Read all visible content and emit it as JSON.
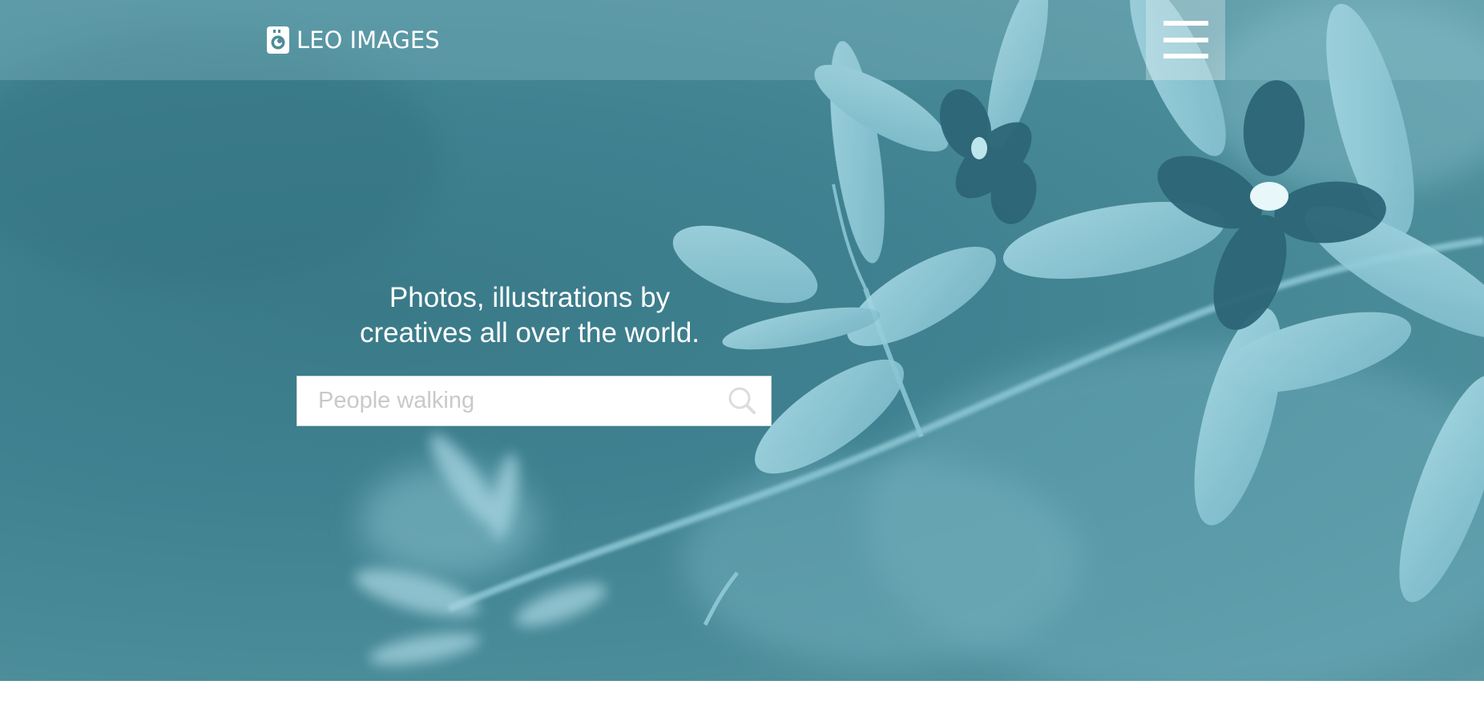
{
  "brand": {
    "name": "LEO IMAGES",
    "icon": "camera-logo-icon"
  },
  "header": {
    "menu_icon": "hamburger-menu-icon"
  },
  "hero": {
    "headline_line1": "Photos, illustrations by",
    "headline_line2": "creatives all over the world.",
    "background_image": "teal-tinted flowering branch photo"
  },
  "search": {
    "placeholder": "People walking",
    "value": "",
    "icon": "search-icon"
  },
  "colors": {
    "hero_tint": "#3f8190",
    "text": "#ffffff",
    "search_bg": "#ffffff",
    "placeholder": "#c9c9c9"
  }
}
